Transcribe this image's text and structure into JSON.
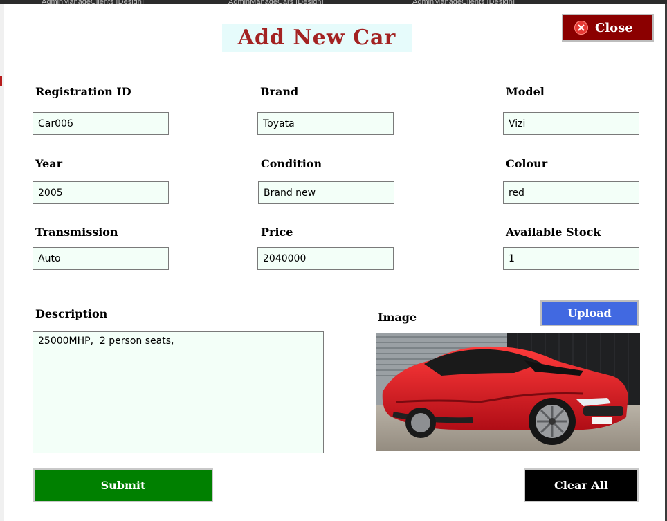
{
  "window": {
    "title": "Add New Car"
  },
  "background_tabs": [
    "AdminManageClients [Design]",
    "AdminManageCars [Design]",
    "AdminManageClients [Design]"
  ],
  "close_button": {
    "label": "Close",
    "icon": "close-circle-icon"
  },
  "fields": {
    "registration_id": {
      "label": "Registration ID",
      "value": "Car006"
    },
    "brand": {
      "label": "Brand",
      "value": "Toyata"
    },
    "model": {
      "label": "Model",
      "value": "Vizi"
    },
    "year": {
      "label": "Year",
      "value": "2005"
    },
    "condition": {
      "label": "Condition",
      "value": "Brand new"
    },
    "colour": {
      "label": "Colour",
      "value": "red"
    },
    "transmission": {
      "label": "Transmission",
      "value": "Auto"
    },
    "price": {
      "label": "Price",
      "value": "2040000"
    },
    "available_stock": {
      "label": "Available Stock",
      "value": "1"
    }
  },
  "description": {
    "label": "Description",
    "value": "25000MHP,  2 person seats,"
  },
  "image": {
    "label": "Image",
    "upload_label": "Upload",
    "content": "red sports car photo"
  },
  "actions": {
    "submit_label": "Submit",
    "clear_label": "Clear All"
  },
  "colors": {
    "title_text": "#a32222",
    "close_button": "#8b0000",
    "upload_button": "#4169e1",
    "submit_button": "#008000",
    "clear_button": "#000000",
    "field_background": "#f3fff8"
  }
}
